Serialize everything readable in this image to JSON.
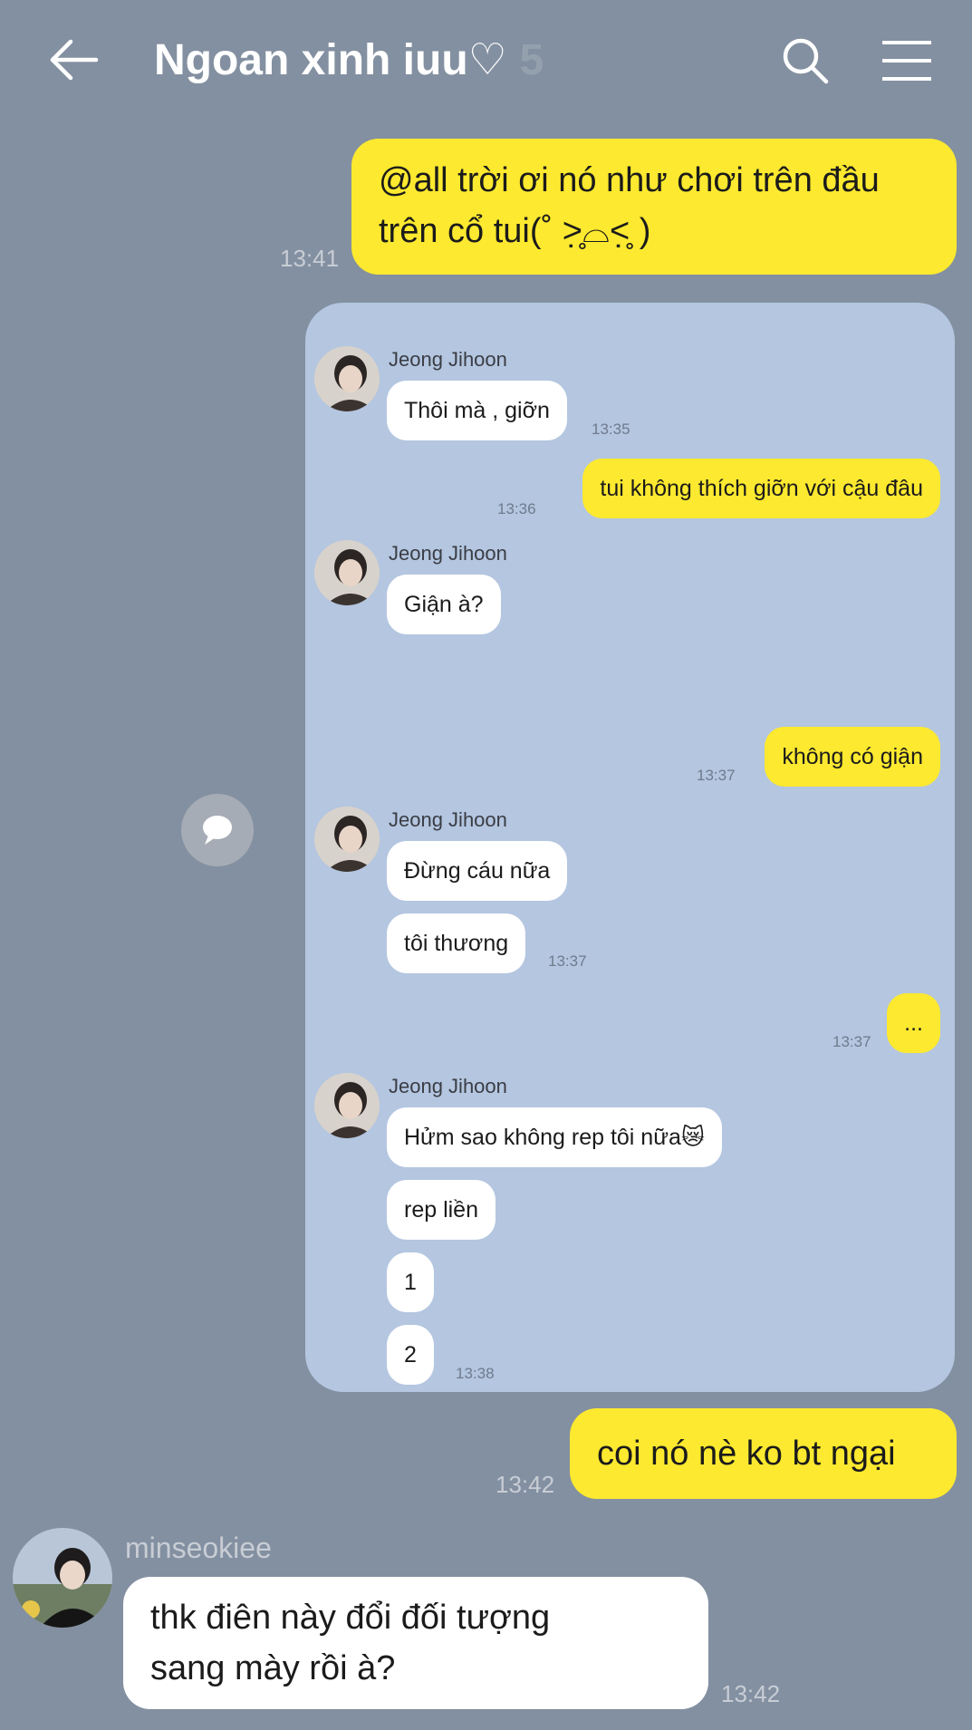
{
  "header": {
    "back_icon": "arrow-left-icon",
    "title": "Ngoan xinh iuu♡",
    "member_count": "5",
    "search_icon": "search-icon",
    "menu_icon": "hamburger-menu-icon"
  },
  "messages": {
    "m1": {
      "text_line1": "@all trời ơi nó như chơi trên đầu",
      "text_line2": "trên cổ tui(˚ ˃̣̣̥⌓˂̣̣̥ )",
      "time": "13:41"
    },
    "m2": {
      "text": "coi nó nè ko bt ngại",
      "time": "13:42"
    },
    "m3": {
      "sender": "minseokiee",
      "text_line1": "thk điên này đổi đối tượng",
      "text_line2": "sang mày rồi à?",
      "time": "13:42"
    }
  },
  "card": {
    "g1": {
      "name": "Jeong Jihoon",
      "b1": "Thôi mà , giỡn",
      "time": "13:35"
    },
    "me1": {
      "text": "tui không thích giỡn với cậu đâu",
      "time": "13:36"
    },
    "g2": {
      "name": "Jeong Jihoon",
      "b1": "Giận à?"
    },
    "me2": {
      "text": "không có giận",
      "time": "13:37"
    },
    "g3": {
      "name": "Jeong Jihoon",
      "b1": "Đừng cáu nữa",
      "b2": "tôi thương",
      "time": "13:37"
    },
    "me3": {
      "text": "...",
      "time": "13:37"
    },
    "g4": {
      "name": "Jeong Jihoon",
      "b1": "Hửm sao không rep tôi nữa😿",
      "b2": "rep liền",
      "b3": "1",
      "b4": "2",
      "time": "13:38"
    }
  },
  "icons": {
    "side": "chat-bubble-icon"
  },
  "colors": {
    "background": "#8390a1",
    "my_bubble": "#fde92f",
    "their_bubble": "#ffffff",
    "card": "#b4c6e0"
  }
}
